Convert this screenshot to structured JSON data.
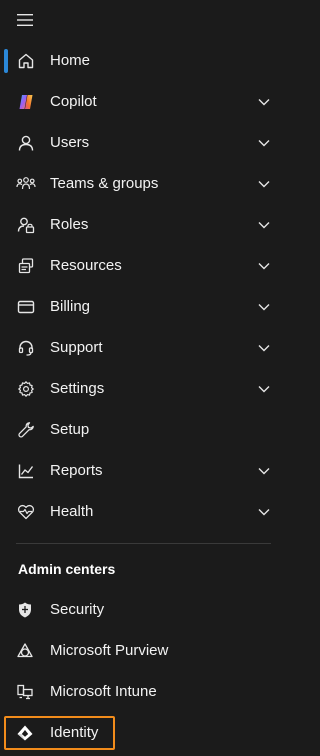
{
  "nav": {
    "items": [
      {
        "label": "Home",
        "icon": "home-icon",
        "active": true,
        "expandable": false
      },
      {
        "label": "Copilot",
        "icon": "copilot-icon",
        "expandable": true
      },
      {
        "label": "Users",
        "icon": "user-icon",
        "expandable": true
      },
      {
        "label": "Teams & groups",
        "icon": "teams-groups-icon",
        "expandable": true
      },
      {
        "label": "Roles",
        "icon": "roles-icon",
        "expandable": true
      },
      {
        "label": "Resources",
        "icon": "resources-icon",
        "expandable": true
      },
      {
        "label": "Billing",
        "icon": "billing-icon",
        "expandable": true
      },
      {
        "label": "Support",
        "icon": "headset-icon",
        "expandable": true
      },
      {
        "label": "Settings",
        "icon": "gear-icon",
        "expandable": true
      },
      {
        "label": "Setup",
        "icon": "wrench-icon",
        "expandable": false
      },
      {
        "label": "Reports",
        "icon": "chart-line-icon",
        "expandable": true
      },
      {
        "label": "Health",
        "icon": "heart-pulse-icon",
        "expandable": true
      }
    ]
  },
  "admin_centers": {
    "title": "Admin centers",
    "items": [
      {
        "label": "Security",
        "icon": "shield-icon"
      },
      {
        "label": "Microsoft Purview",
        "icon": "purview-icon"
      },
      {
        "label": "Microsoft Intune",
        "icon": "intune-icon"
      },
      {
        "label": "Identity",
        "icon": "identity-icon",
        "highlighted": true
      }
    ]
  },
  "colors": {
    "background": "#1b1b1b",
    "active_indicator": "#2b88d8",
    "highlight_border": "#f28c1b",
    "text": "#f3f3f3"
  }
}
